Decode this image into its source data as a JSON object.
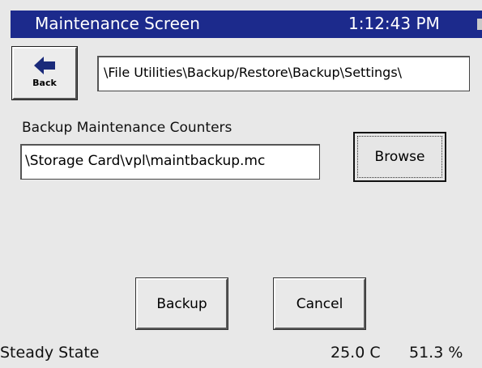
{
  "titlebar": {
    "title": "Maintenance Screen",
    "clock": "1:12:43 PM"
  },
  "back_button": {
    "label": "Back",
    "icon": "back-arrow-icon"
  },
  "path": {
    "value": "\\File Utilities\\Backup/Restore\\Backup\\Settings\\"
  },
  "backup_section": {
    "label": "Backup Maintenance Counters",
    "file_value": "\\Storage Card\\vpl\\maintbackup.mc",
    "browse_label": "Browse"
  },
  "actions": {
    "backup_label": "Backup",
    "cancel_label": "Cancel"
  },
  "status": {
    "state": "Steady State",
    "temperature": "25.0 C",
    "humidity": "51.3 %"
  },
  "colors": {
    "titlebar": "#1c2a8c",
    "background": "#e8e8e8",
    "back_arrow": "#1a2a7a"
  }
}
